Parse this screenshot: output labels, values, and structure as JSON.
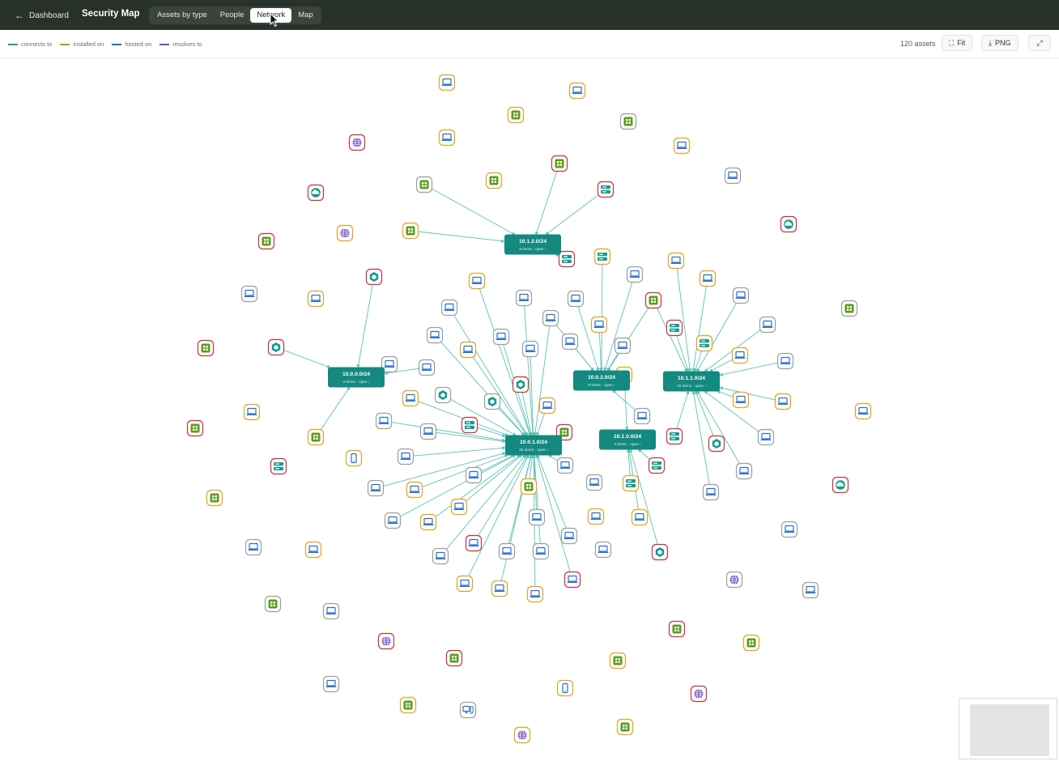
{
  "header": {
    "back_label": "Dashboard",
    "title": "Security Map",
    "tabs": [
      {
        "label": "Assets by type",
        "active": false
      },
      {
        "label": "People",
        "active": false
      },
      {
        "label": "Network",
        "active": true
      },
      {
        "label": "Map",
        "active": false
      }
    ]
  },
  "legend": [
    {
      "label": "connects to",
      "color": "#14a08a"
    },
    {
      "label": "installed on",
      "color": "#7fb21e"
    },
    {
      "label": "hosted on",
      "color": "#1f6fd6"
    },
    {
      "label": "resolves to",
      "color": "#6b4fc4"
    }
  ],
  "toolbar": {
    "asset_count": "120 assets",
    "fit_label": "Fit",
    "png_label": "PNG"
  },
  "colors": {
    "cluster": "#13897f",
    "edge": "#5cc2b4",
    "risk_high": "#c9323c",
    "risk_medium": "#e7a21c",
    "risk_low": "#9aa09a"
  },
  "clusters": [
    {
      "label": "10.1.2.0/24",
      "meta": "5 items · open ›"
    },
    {
      "label": "10.0.0.0/24",
      "meta": "4 items · open ›"
    },
    {
      "label": "10.0.2.0/24",
      "meta": "9 items · open ›"
    },
    {
      "label": "10.1.1.0/24",
      "meta": "15 items · open ›"
    },
    {
      "label": "10.0.1.0/24",
      "meta": "35 items · open ›"
    },
    {
      "label": "10.1.0.0/24",
      "meta": "4 items · open ›"
    }
  ]
}
